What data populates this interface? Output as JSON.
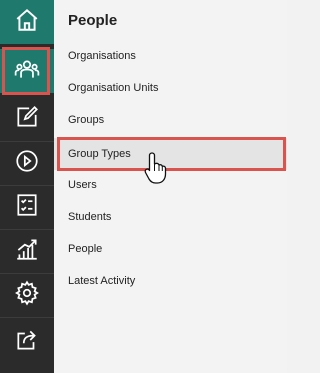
{
  "sidebar": {
    "icons": [
      {
        "name": "home-icon"
      },
      {
        "name": "people-icon"
      },
      {
        "name": "edit-icon"
      },
      {
        "name": "play-icon"
      },
      {
        "name": "checklist-icon"
      },
      {
        "name": "chart-icon"
      },
      {
        "name": "gear-icon"
      },
      {
        "name": "export-icon"
      }
    ]
  },
  "panel": {
    "title": "People",
    "items": [
      {
        "label": "Organisations"
      },
      {
        "label": "Organisation Units"
      },
      {
        "label": "Groups"
      },
      {
        "label": "Group Types"
      },
      {
        "label": "Users"
      },
      {
        "label": "Students"
      },
      {
        "label": "People"
      },
      {
        "label": "Latest Activity"
      }
    ]
  },
  "colors": {
    "rail_bg": "#2b2b2b",
    "teal": "#1f7a6d",
    "highlight": "#d9534f"
  }
}
